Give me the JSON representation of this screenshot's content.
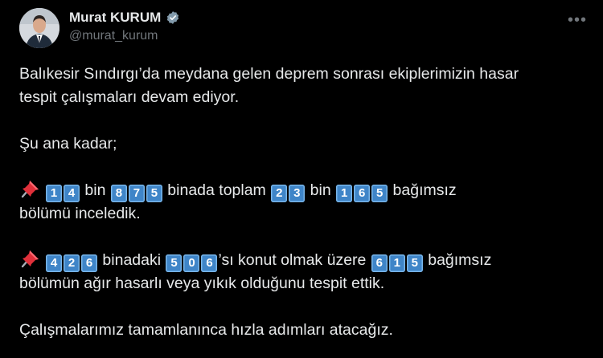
{
  "author": {
    "display_name": "Murat KURUM",
    "handle": "@murat_kurum",
    "verified_color": "#829aab"
  },
  "menu_icon": "more-horizontal-icon",
  "tweet": {
    "line1": "Balıkesir Sındırgı’da meydana gelen deprem sonrası ekiplerimizin hasar",
    "line2": "tespit çalışmaları devam ediyor.",
    "line3": "Şu ana kadar;",
    "p1": {
      "icon": "pushpin-icon",
      "n1": [
        "1",
        "4"
      ],
      "t1": "bin",
      "n2": [
        "8",
        "7",
        "5"
      ],
      "t2": "binada toplam",
      "n3": [
        "2",
        "3"
      ],
      "t3": "bin",
      "n4": [
        "1",
        "6",
        "5"
      ],
      "t4": "bağımsız",
      "cont": "bölümü inceledik."
    },
    "p2": {
      "icon": "pushpin-icon",
      "n1": [
        "4",
        "2",
        "6"
      ],
      "t1": "binadaki",
      "n2": [
        "5",
        "0",
        "6"
      ],
      "t2": "’sı konut olmak üzere",
      "n3": [
        "6",
        "1",
        "5"
      ],
      "t3": "bağımsız",
      "cont": "bölümün ağır hasarlı veya yıkık olduğunu tespit ettik."
    },
    "closing": "Çalışmalarımız tamamlanınca hızla adımları atacağız."
  },
  "colors": {
    "keycap": "#3f85c8",
    "text": "#e7e9ea",
    "muted": "#71767b"
  }
}
